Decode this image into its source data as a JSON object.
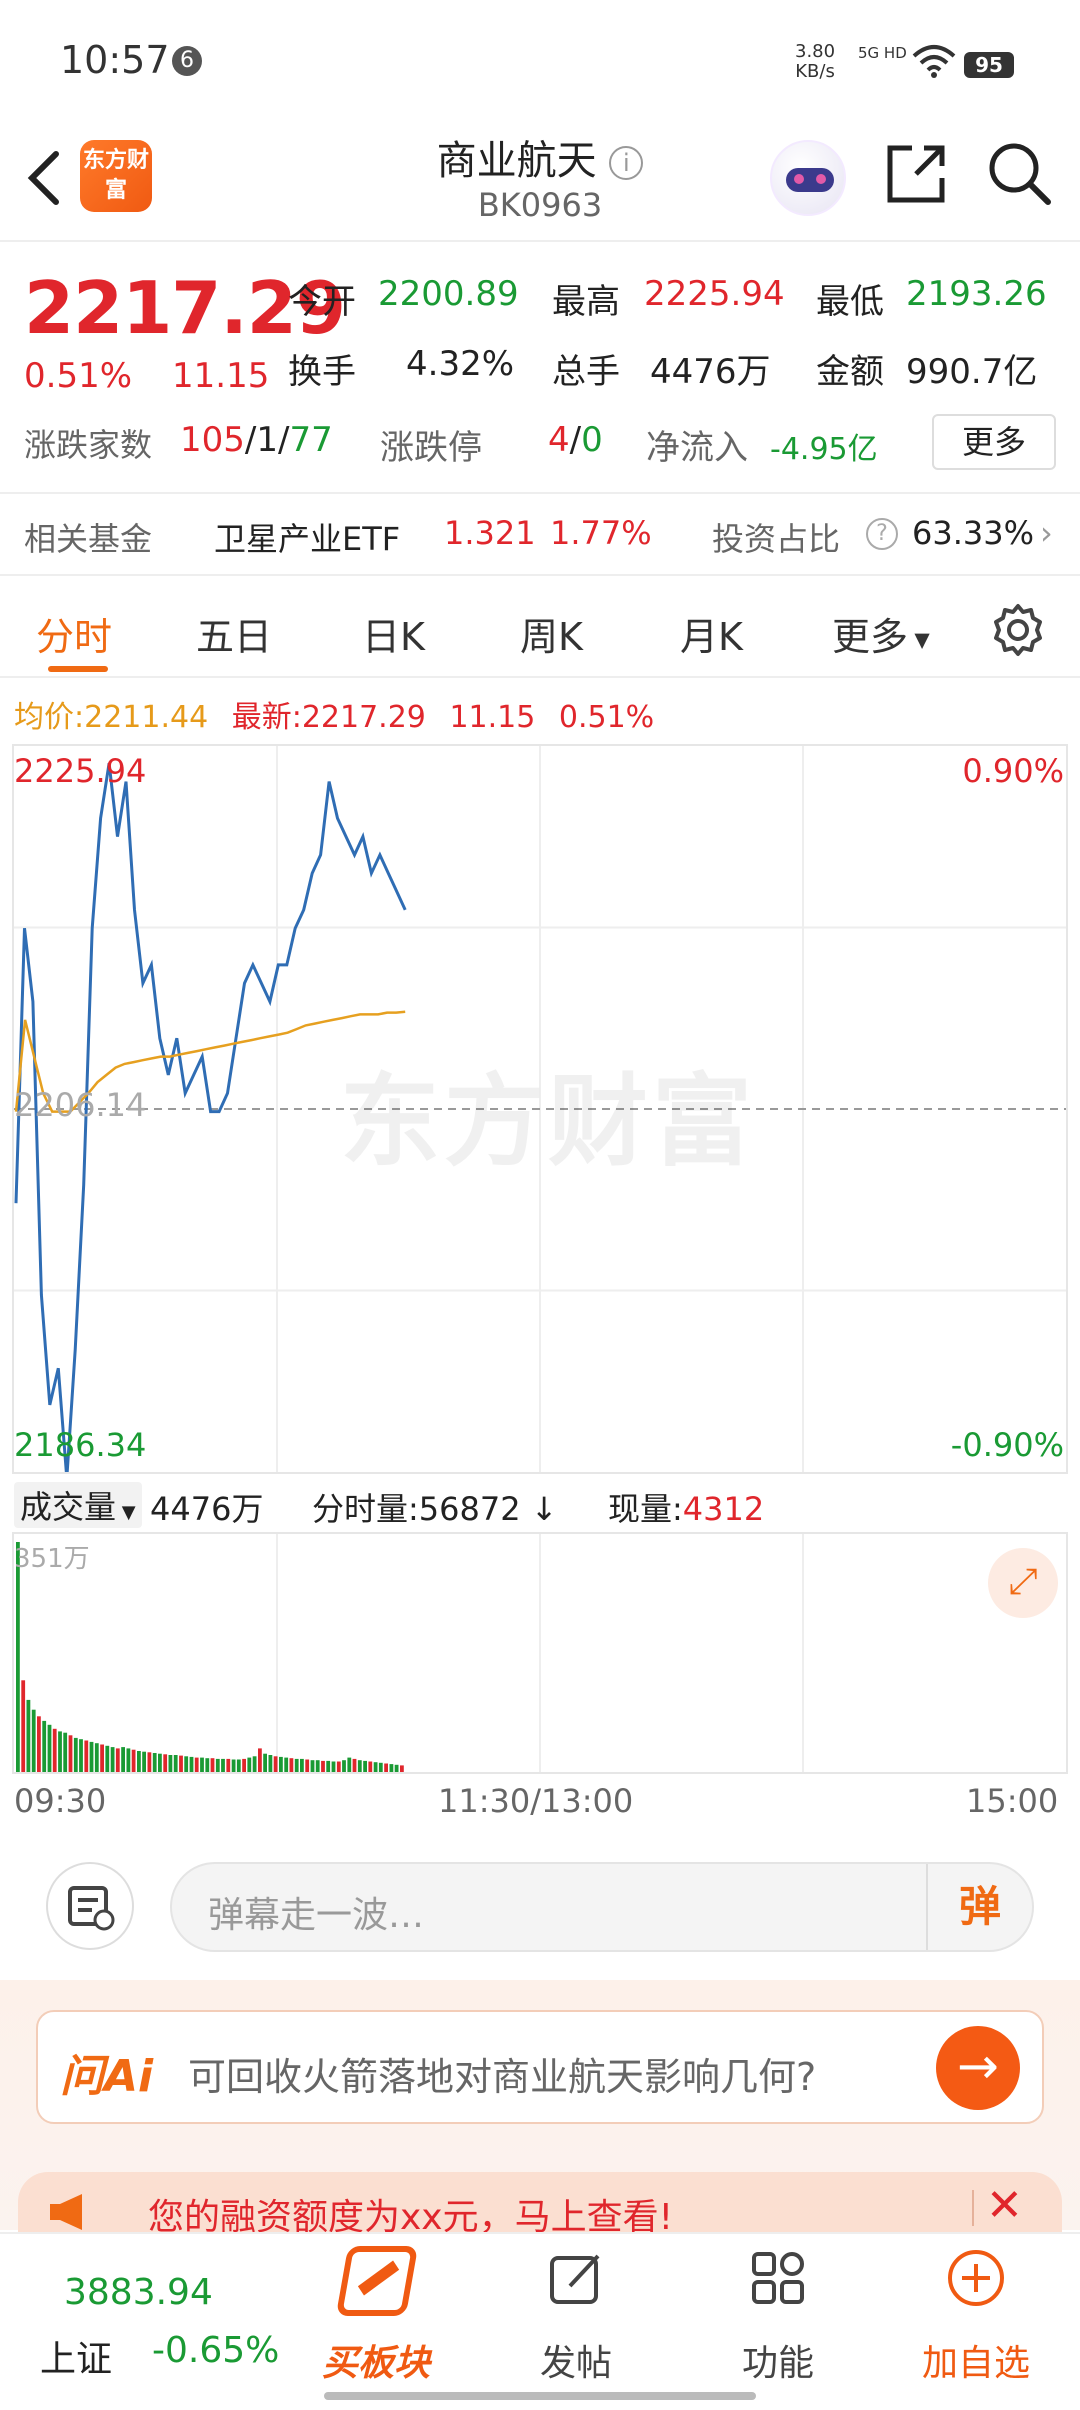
{
  "status_bar": {
    "time": "10:57",
    "notif_count": "6",
    "net_speed": "3.80",
    "net_unit": "KB/s",
    "signal": "5G HD",
    "battery": "95"
  },
  "header": {
    "logo_text": "东方财富",
    "title": "商业航天",
    "code": "BK0963"
  },
  "quote": {
    "price": "2217.29",
    "change_pct": "0.51%",
    "change": "11.15",
    "open_label": "今开",
    "open": "2200.89",
    "high_label": "最高",
    "high": "2225.94",
    "low_label": "最低",
    "low": "2193.26",
    "turnover_label": "换手",
    "turnover": "4.32%",
    "volume_label": "总手",
    "volume": "4476万",
    "amount_label": "金额",
    "amount": "990.7亿",
    "breadth_label": "涨跌家数",
    "breadth_up": "105",
    "breadth_flat": "1",
    "breadth_down": "77",
    "limit_label": "涨跌停",
    "limit_up": "4",
    "limit_down": "0",
    "inflow_label": "净流入",
    "inflow": "-4.95亿",
    "more_label": "更多"
  },
  "fund": {
    "label": "相关基金",
    "name": "卫星产业ETF",
    "price": "1.321",
    "pct": "1.77%",
    "ratio_label": "投资占比",
    "ratio": "63.33%"
  },
  "tabs": [
    "分时",
    "五日",
    "日K",
    "周K",
    "月K",
    "更多"
  ],
  "info": {
    "avg_label": "均价:",
    "avg": "2211.44",
    "latest_label": "最新:",
    "latest": "2217.29",
    "chg": "11.15",
    "pct": "0.51%"
  },
  "chart_data": {
    "type": "line",
    "title": "",
    "y_left_top": "2225.94",
    "y_left_mid": "2206.14",
    "y_left_bottom": "2186.34",
    "y_right_top": "0.90%",
    "y_right_bottom": "-0.90%",
    "ylim": [
      2186.34,
      2225.94
    ],
    "x_labels": [
      "09:30",
      "11:30/13:00",
      "15:00"
    ],
    "series": [
      {
        "values": [
          2201,
          2216,
          2212,
          2196,
          2190,
          2192,
          2186,
          2193,
          2202,
          2216,
          2222,
          2225,
          2221,
          2224,
          2217,
          2213,
          2214,
          2210,
          2208,
          2210,
          2207,
          2208,
          2209,
          2206,
          2206,
          2207,
          2210,
          2213,
          2214,
          2213,
          2212,
          2214,
          2214,
          2216,
          2217,
          2219,
          2220,
          2224,
          2222,
          2221,
          2220,
          2221,
          2219,
          2220,
          2219,
          2218,
          2217
        ]
      },
      {
        "values": [
          2206,
          2211,
          2209,
          2207,
          2206,
          2206,
          2206,
          2206.5,
          2207,
          2207.6,
          2208,
          2208.4,
          2208.6,
          2208.7,
          2208.8,
          2208.9,
          2209,
          2209,
          2209.1,
          2209.2,
          2209.3,
          2209.4,
          2209.5,
          2209.6,
          2209.7,
          2209.8,
          2209.9,
          2210,
          2210.1,
          2210.2,
          2210.3,
          2210.5,
          2210.7,
          2210.8,
          2210.9,
          2211,
          2211.1,
          2211.2,
          2211.3,
          2211.3,
          2211.3,
          2211.4,
          2211.4,
          2211.44
        ]
      }
    ]
  },
  "volume": {
    "selector": "成交量",
    "total": "4476万",
    "tick_label": "分时量:",
    "tick": "56872",
    "now_label": "现量:",
    "now": "4312",
    "max_label": "351万",
    "bars": [
      351,
      140,
      110,
      95,
      85,
      78,
      72,
      66,
      62,
      60,
      56,
      52,
      50,
      48,
      46,
      44,
      42,
      40,
      38,
      36,
      38,
      36,
      34,
      32,
      31,
      30,
      29,
      28,
      27,
      26,
      26,
      25,
      24,
      23,
      22,
      22,
      21,
      21,
      20,
      20,
      20,
      19,
      19,
      20,
      22,
      24,
      36,
      28,
      26,
      24,
      23,
      22,
      21,
      20,
      20,
      19,
      18,
      18,
      17,
      17,
      16,
      16,
      18,
      22,
      20,
      18,
      17,
      16,
      15,
      14,
      13,
      12,
      11,
      10
    ],
    "bar_colors": [
      "#e0262c",
      "#1a9a34"
    ]
  },
  "danmu": {
    "placeholder": "弹幕走一波…",
    "button": "弹"
  },
  "ai": {
    "logo": "问Ai",
    "question": "可回收火箭落地对商业航天影响几何?"
  },
  "banner": {
    "text": "您的融资额度为xx元，马上查看!"
  },
  "nav": {
    "index_value": "3883.94",
    "index_name": "上证",
    "index_pct": "-0.65%",
    "buy_label": "买板块",
    "post_label": "发帖",
    "func_label": "功能",
    "watch_label": "加自选"
  },
  "watermark": "东方财富"
}
